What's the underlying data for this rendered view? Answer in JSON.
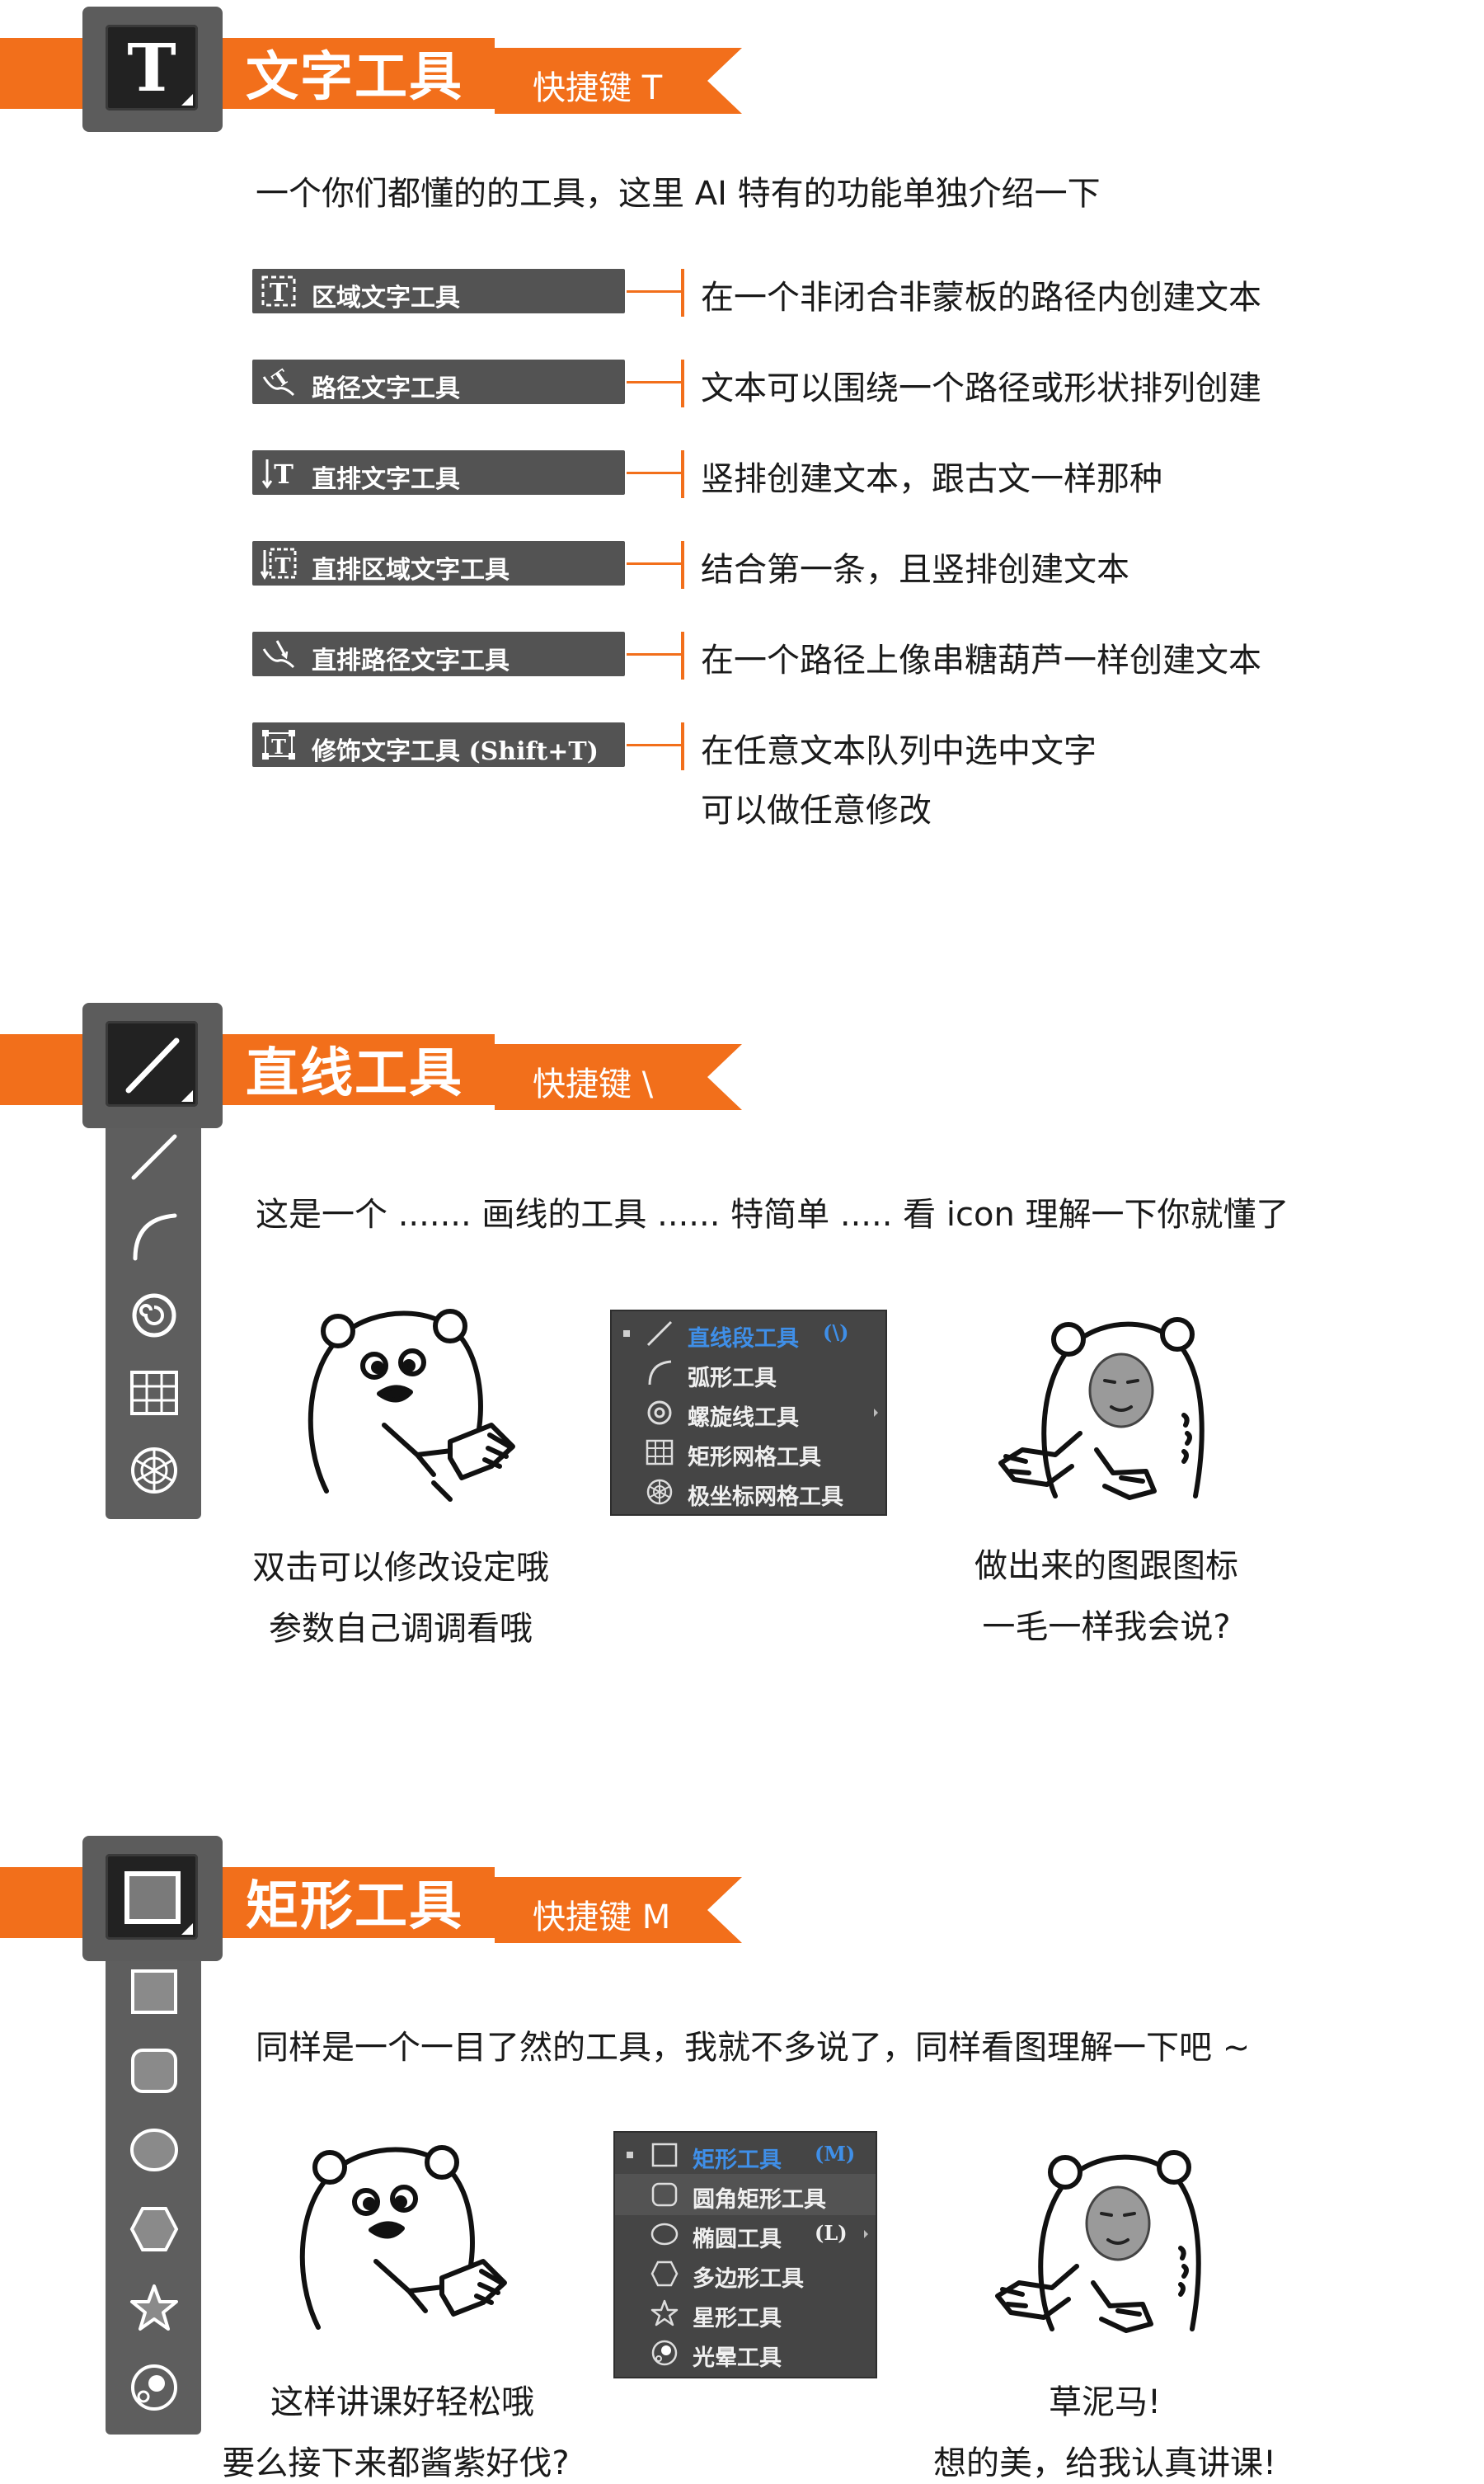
{
  "sections": {
    "text": {
      "title": "文字工具",
      "shortcut": "快捷键  T",
      "intro": "一个你们都懂的的工具，这里 AI 特有的功能单独介绍一下",
      "tools": [
        {
          "icon": "area-type-icon",
          "label": "区域文字工具",
          "desc": "在一个非闭合非蒙板的路径内创建文本"
        },
        {
          "icon": "path-type-icon",
          "label": "路径文字工具",
          "desc": "文本可以围绕一个路径或形状排列创建"
        },
        {
          "icon": "vertical-type-icon",
          "label": "直排文字工具",
          "desc": "竖排创建文本，跟古文一样那种"
        },
        {
          "icon": "vertical-area-type-icon",
          "label": "直排区域文字工具",
          "desc": "结合第一条，且竖排创建文本"
        },
        {
          "icon": "vertical-path-type-icon",
          "label": "直排路径文字工具",
          "desc": "在一个路径上像串糖葫芦一样创建文本"
        },
        {
          "icon": "touch-type-icon",
          "label": "修饰文字工具  (Shift+T)",
          "desc": "在任意文本队列中选中文字",
          "desc2": "可以做任意修改"
        }
      ]
    },
    "line": {
      "title": "直线工具",
      "shortcut": "快捷键  \\",
      "intro": "这是一个 ....... 画线的工具 ...... 特简单 ..... 看 icon 理解一下你就懂了",
      "menu": [
        {
          "icon": "line-segment-icon",
          "label": "直线段工具",
          "key": "(\\)",
          "selected": true
        },
        {
          "icon": "arc-icon",
          "label": "弧形工具",
          "key": "",
          "selected": false
        },
        {
          "icon": "spiral-icon",
          "label": "螺旋线工具",
          "key": "",
          "selected": false
        },
        {
          "icon": "rect-grid-icon",
          "label": "矩形网格工具",
          "key": "",
          "selected": false
        },
        {
          "icon": "polar-grid-icon",
          "label": "极坐标网格工具",
          "key": "",
          "selected": false
        }
      ],
      "caption_left": [
        "双击可以修改设定哦",
        "参数自己调调看哦"
      ],
      "caption_right": [
        "做出来的图跟图标",
        "一毛一样我会说?"
      ]
    },
    "rect": {
      "title": "矩形工具",
      "shortcut": "快捷键  M",
      "intro": "同样是一个一目了然的工具，我就不多说了，同样看图理解一下吧 ~",
      "menu": [
        {
          "icon": "rectangle-icon",
          "label": "矩形工具",
          "key": "(M)",
          "selected": true
        },
        {
          "icon": "rounded-rect-icon",
          "label": "圆角矩形工具",
          "key": "",
          "selected": false
        },
        {
          "icon": "ellipse-icon",
          "label": "椭圆工具",
          "key": "(L)",
          "selected": false
        },
        {
          "icon": "polygon-icon",
          "label": "多边形工具",
          "key": "",
          "selected": false
        },
        {
          "icon": "star-icon",
          "label": "星形工具",
          "key": "",
          "selected": false
        },
        {
          "icon": "flare-icon",
          "label": "光晕工具",
          "key": "",
          "selected": false
        }
      ],
      "caption_left": [
        "这样讲课好轻松哦",
        "要么接下来都酱紫好伐?"
      ],
      "caption_right": [
        "草泥马!",
        "想的美，给我认真讲课!"
      ]
    }
  },
  "colors": {
    "accent": "#f26f1b",
    "panel": "#535353",
    "menu": "#454545",
    "selected": "#3f8fe8"
  }
}
